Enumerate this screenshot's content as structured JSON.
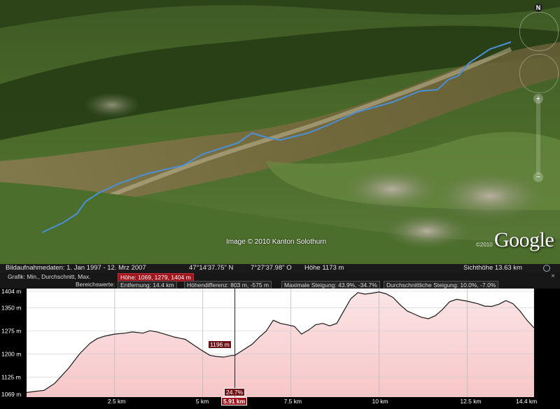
{
  "map": {
    "copyright": "Image © 2010 Kanton Solothurn",
    "logo": "Google",
    "logo_year": "©2010",
    "compass_label": "N",
    "zoom_in": "+",
    "zoom_out": "−"
  },
  "status": {
    "imagery_date": "Bildaufnahmedaten:  1. Jan 1997  -  12. Mrz 2007",
    "lat": "47°14'37.75\" N",
    "lon": "7°27'37.98\" O",
    "altitude": "Höhe  1173 m",
    "eye_alt": "Sichthöhe    13.63 km"
  },
  "panel": {
    "graph_label": "Grafik: Min., Durchschnitt, Max.",
    "height_stats": "Höhe: 1069, 1279, 1404 m",
    "range_label": "Bereichswerte:",
    "distance": "Entfernung: 14.4 km",
    "elev_diff": "Höhendifferenz: 803 m, -575 m",
    "max_slope": "Maximale Steigung: 43.9%, -34.7%",
    "avg_slope": "Durchschnittliche Steigung: 10.0%, -7.0%",
    "close": "×"
  },
  "chart_data": {
    "type": "area",
    "title": "",
    "xlabel": "",
    "ylabel": "",
    "xlim": [
      0,
      14.4
    ],
    "ylim": [
      1060,
      1404
    ],
    "y_ticks": [
      "1404 m",
      "1350 m",
      "1275 m",
      "1200 m",
      "1125 m",
      "1069 m"
    ],
    "y_tick_values": [
      1404,
      1350,
      1275,
      1200,
      1125,
      1069
    ],
    "x_ticks": [
      "2.5 km",
      "5 km",
      "7.5 km",
      "10 km",
      "12.5 km",
      "14.4 km"
    ],
    "x_tick_values": [
      2.5,
      5,
      7.5,
      10,
      12.5,
      14.4
    ],
    "fill_color": "#f7c6c8",
    "line_color": "#1a1a1a",
    "series": [
      {
        "x": [
          0,
          0.2,
          0.5,
          0.8,
          1.0,
          1.2,
          1.5,
          1.8,
          2.0,
          2.2,
          2.5,
          2.8,
          3.0,
          3.3,
          3.5,
          3.7,
          4.0,
          4.2,
          4.5,
          4.8,
          5.0,
          5.2,
          5.4,
          5.6,
          5.8,
          5.91,
          6.1,
          6.4,
          6.6,
          6.8,
          7.0,
          7.2,
          7.4,
          7.6,
          7.8,
          8.0,
          8.2,
          8.4,
          8.6,
          8.8,
          9.0,
          9.2,
          9.4,
          9.6,
          9.8,
          10.0,
          10.2,
          10.4,
          10.6,
          10.8,
          11.0,
          11.2,
          11.4,
          11.6,
          11.8,
          12.0,
          12.2,
          12.5,
          12.8,
          13.0,
          13.2,
          13.4,
          13.6,
          13.8,
          14.0,
          14.2,
          14.4
        ],
        "y": [
          1075,
          1078,
          1082,
          1105,
          1130,
          1155,
          1200,
          1235,
          1250,
          1258,
          1265,
          1268,
          1272,
          1268,
          1276,
          1272,
          1262,
          1255,
          1248,
          1225,
          1210,
          1196,
          1192,
          1190,
          1195,
          1196,
          1210,
          1232,
          1255,
          1275,
          1310,
          1300,
          1295,
          1290,
          1265,
          1278,
          1295,
          1300,
          1292,
          1300,
          1340,
          1380,
          1400,
          1395,
          1398,
          1402,
          1396,
          1384,
          1360,
          1340,
          1330,
          1320,
          1315,
          1325,
          1345,
          1370,
          1378,
          1372,
          1364,
          1356,
          1355,
          1362,
          1374,
          1364,
          1340,
          1310,
          1285
        ]
      }
    ],
    "grid": true
  },
  "markers": {
    "height_value": "1196 m",
    "slope_value": "24.7%",
    "distance_value": "5.91 km"
  }
}
